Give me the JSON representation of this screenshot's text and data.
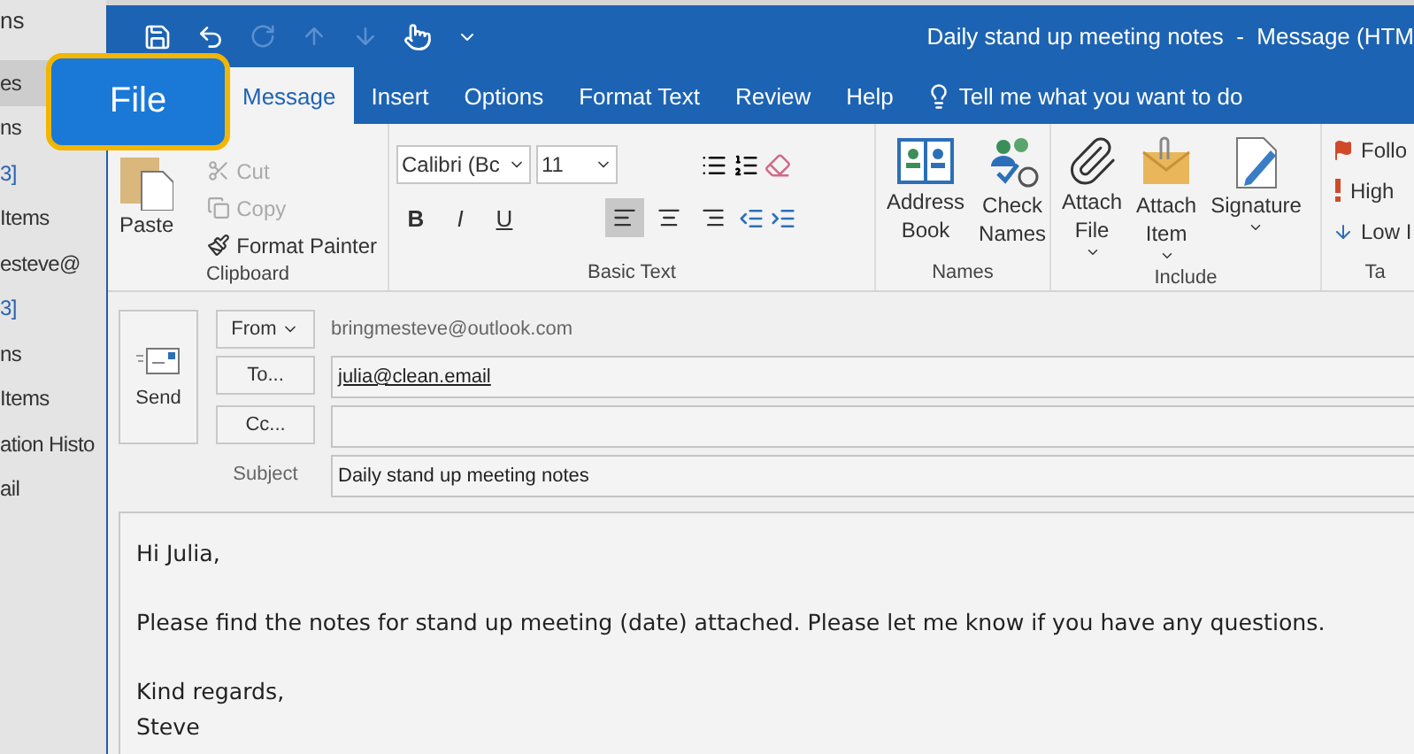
{
  "background": {
    "top_menu": "ns",
    "sidebar_items": [
      {
        "label": "es",
        "selected": true
      },
      {
        "label": "ns",
        "selected": false
      },
      {
        "label": "3]",
        "selected": false
      },
      {
        "label": "Items",
        "selected": false
      },
      {
        "label": "esteve@",
        "selected": false
      },
      {
        "label": "3]",
        "selected": false
      },
      {
        "label": "ns",
        "selected": false
      },
      {
        "label": "Items",
        "selected": false
      },
      {
        "label": "ation Histo",
        "selected": false
      },
      {
        "label": "ail",
        "selected": false
      }
    ]
  },
  "file_callout": {
    "label": "File"
  },
  "window": {
    "title": "Daily stand up meeting notes  -  Message (HTM"
  },
  "tabs": [
    {
      "label": "Message",
      "selected": true
    },
    {
      "label": "Insert",
      "selected": false
    },
    {
      "label": "Options",
      "selected": false
    },
    {
      "label": "Format Text",
      "selected": false
    },
    {
      "label": "Review",
      "selected": false
    },
    {
      "label": "Help",
      "selected": false
    }
  ],
  "tell_me": "Tell me what you want to do",
  "ribbon": {
    "clipboard": {
      "label": "Clipboard",
      "paste": "Paste",
      "items": [
        {
          "kind": "cut",
          "label": "Cut",
          "disabled": true
        },
        {
          "kind": "copy",
          "label": "Copy",
          "disabled": true
        },
        {
          "kind": "painter",
          "label": "Format Painter",
          "disabled": false
        }
      ]
    },
    "basic_text": {
      "label": "Basic Text",
      "font": "Calibri (Bc",
      "size": "11",
      "format_buttons": [
        {
          "kind": "bold",
          "label": "B"
        },
        {
          "kind": "italic",
          "label": "I"
        },
        {
          "kind": "underline",
          "label": "U"
        }
      ],
      "alignment": [
        {
          "kind": "left",
          "selected": true
        },
        {
          "kind": "center",
          "selected": false
        },
        {
          "kind": "right",
          "selected": false
        }
      ]
    },
    "names": {
      "label": "Names",
      "items": [
        {
          "kind": "address",
          "lines": [
            "Address",
            "Book"
          ]
        },
        {
          "kind": "check",
          "lines": [
            "Check",
            "Names"
          ]
        }
      ]
    },
    "include": {
      "label": "Include",
      "items": [
        {
          "kind": "file",
          "lines": [
            "Attach",
            "File"
          ]
        },
        {
          "kind": "item",
          "lines": [
            "Attach",
            "Item"
          ]
        },
        {
          "kind": "signature",
          "lines": [
            "Signature"
          ]
        }
      ]
    },
    "tags": {
      "label": "Ta",
      "items": [
        {
          "kind": "flag",
          "label": "Follo"
        },
        {
          "kind": "high",
          "label": "High"
        },
        {
          "kind": "low",
          "label": "Low I"
        }
      ]
    }
  },
  "compose": {
    "send": "Send",
    "from_button": "From",
    "from_address": "bringmesteve@outlook.com",
    "to_button": "To...",
    "to_value": "julia@clean.email",
    "cc_button": "Cc...",
    "subject_label": "Subject",
    "subject_value": "Daily stand up meeting notes"
  },
  "body": [
    {
      "lines": [
        "Hi Julia,"
      ]
    },
    {
      "lines": [
        "Please find the notes for stand up meeting (date) attached. Please let me know if you have any questions."
      ]
    },
    {
      "lines": [
        "Kind regards,",
        "Steve"
      ]
    }
  ]
}
